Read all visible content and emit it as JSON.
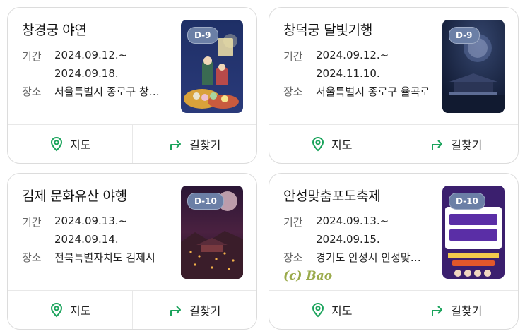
{
  "common": {
    "date_label": "기간",
    "place_label": "장소",
    "map_label": "지도",
    "directions_label": "길찾기"
  },
  "cards": [
    {
      "title": "창경궁 야연",
      "date_start": "2024.09.12.~",
      "date_end": "2024.09.18.",
      "place": "서울특별시 종로구 창경궁로",
      "badge": "D-9"
    },
    {
      "title": "창덕궁 달빛기행",
      "date_start": "2024.09.12.~",
      "date_end": "2024.11.10.",
      "place": "서울특별시 종로구 율곡로",
      "badge": "D-9"
    },
    {
      "title": "김제 문화유산 야행",
      "date_start": "2024.09.13.~",
      "date_end": "2024.09.14.",
      "place": "전북특별자치도 김제시",
      "badge": "D-10"
    },
    {
      "title": "안성맞춤포도축제",
      "date_start": "2024.09.13.~",
      "date_end": "2024.09.15.",
      "place": "경기도 안성시 안성맞춤대로",
      "badge": "D-10"
    }
  ],
  "watermark": "(c) Bao",
  "colors": {
    "accent_green": "#1aa35b",
    "badge_bg": "#6b7fa6"
  }
}
